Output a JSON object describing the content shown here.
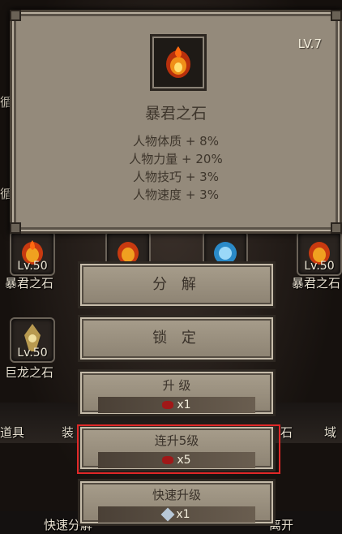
{
  "tooltip": {
    "level": "LV.7",
    "name": "暴君之石",
    "stats": [
      "人物体质 + 8%",
      "人物力量 + 20%",
      "人物技巧 + 3%",
      "人物速度 + 3%"
    ]
  },
  "background": {
    "slot_tyrant_left_level": "Lv.50",
    "slot_tyrant_left_label": "暴君之石",
    "slot_tyrant_right_level": "Lv.50",
    "slot_tyrant_right_label": "暴君之石",
    "slot_dragon_level": "Lv.50",
    "slot_dragon_label": "巨龙之石",
    "edge_char_1": "循",
    "edge_char_2": "循",
    "tab_items": "道具",
    "tab_equip": "装",
    "tab_stone": "石",
    "tab_domain": "域",
    "quick_decompose": "快速分解",
    "leave": "离开"
  },
  "actions": {
    "decompose": "分 解",
    "lock": "锁 定",
    "upgrade": {
      "title": "升 级",
      "cost": "x1"
    },
    "upgrade5": {
      "title": "连升5级",
      "cost": "x5"
    },
    "quick_upgrade": {
      "title": "快速升级",
      "cost": "x1"
    }
  },
  "colors": {
    "highlight": "#e02828",
    "panel": "#948a7b"
  }
}
